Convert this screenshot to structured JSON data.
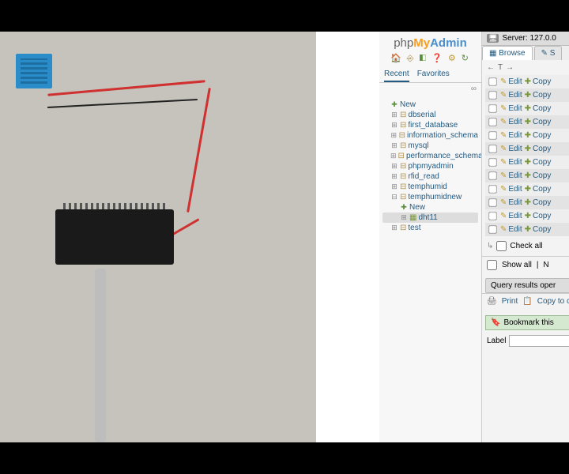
{
  "logo": {
    "php": "php",
    "my": "My",
    "admin": "Admin"
  },
  "sidebar": {
    "tabs": {
      "recent": "Recent",
      "favorites": "Favorites"
    },
    "dash": "∞",
    "tree": {
      "new": "New",
      "selected": "dht11",
      "items": [
        "dbserial",
        "first_database",
        "information_schema",
        "mysql",
        "performance_schema",
        "phpmyadmin",
        "rfid_read",
        "temphumid",
        "temphumidnew"
      ],
      "expanded_children": {
        "new": "New",
        "table": "dht11"
      },
      "after": [
        "test"
      ]
    }
  },
  "server_bar": {
    "label": "Server: 127.0.0"
  },
  "main_tabs": {
    "browse": "Browse",
    "structure": "S"
  },
  "table_controls": {
    "left_arrow": "←",
    "t_icon": "T",
    "right_arrow": "→"
  },
  "row_actions": {
    "edit": "Edit",
    "copy": "Copy"
  },
  "row_count": 12,
  "checkall": {
    "label": "Check all"
  },
  "options": {
    "show_all": "Show all",
    "num": "N"
  },
  "query_ops": {
    "header": "Query results oper",
    "print": "Print",
    "copy": "Copy to c"
  },
  "bookmark": {
    "header": "Bookmark this"
  },
  "label_field": {
    "label": "Label"
  }
}
